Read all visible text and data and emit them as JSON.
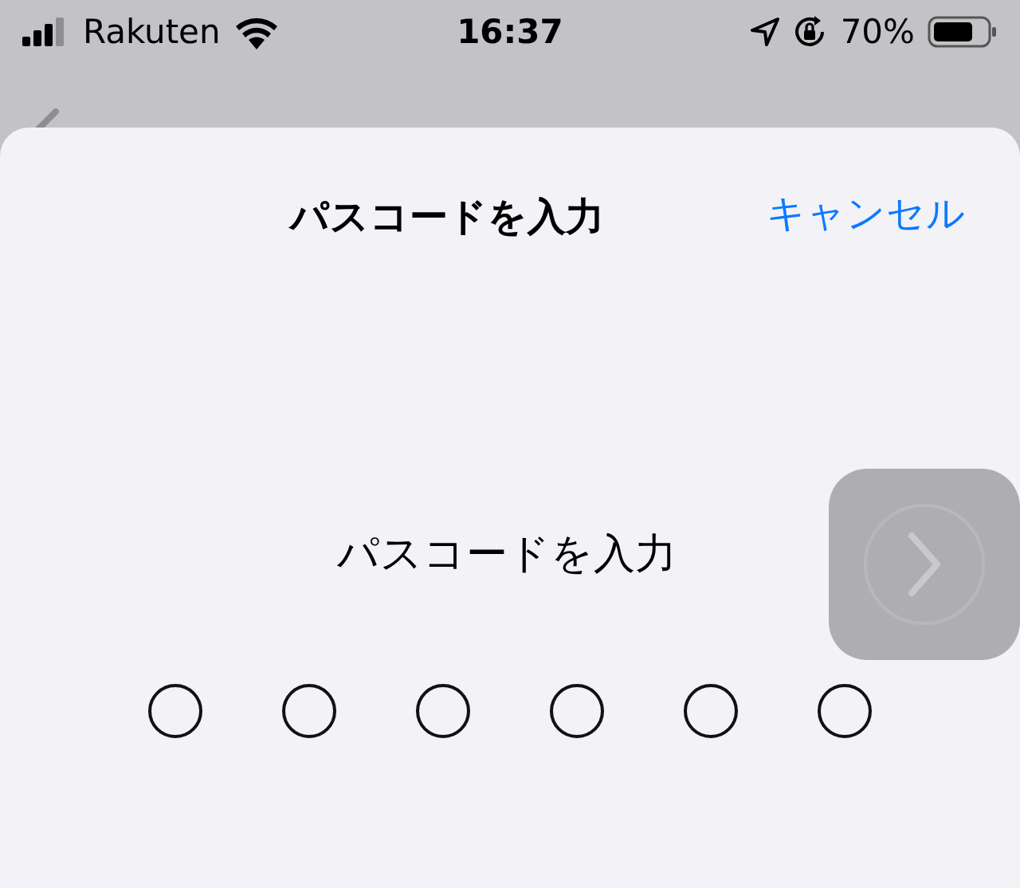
{
  "status_bar": {
    "carrier": "Rakuten",
    "time": "16:37",
    "battery": "70%"
  },
  "sheet": {
    "title": "パスコードを入力",
    "cancel": "キャンセル",
    "prompt": "パスコードを入力",
    "digits": [
      {
        "filled": false
      },
      {
        "filled": false
      },
      {
        "filled": false
      },
      {
        "filled": false
      },
      {
        "filled": false
      },
      {
        "filled": false
      }
    ],
    "next_button": {
      "disabled": true
    }
  }
}
